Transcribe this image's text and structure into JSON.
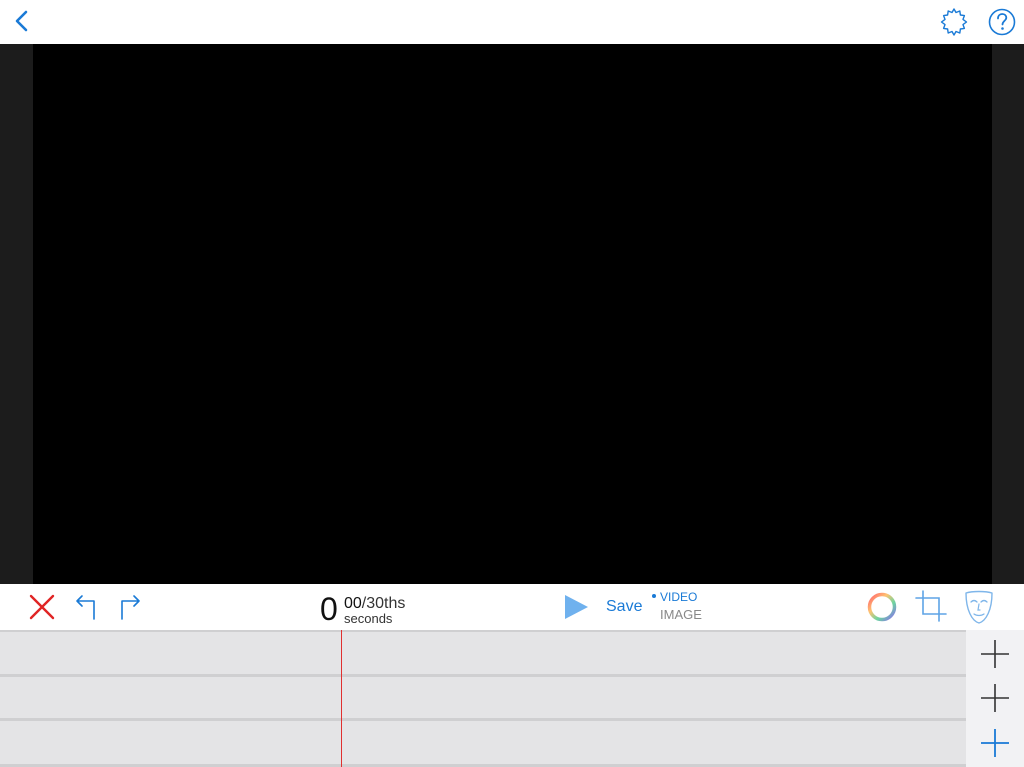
{
  "nav": {
    "back_icon": "chevron-left-icon",
    "settings_icon": "gear-icon",
    "help_icon": "question-mark-icon"
  },
  "toolbar": {
    "cancel_icon": "close-icon",
    "undo_icon": "undo-arrow-icon",
    "redo_icon": "redo-arrow-icon",
    "time": {
      "seconds": "0",
      "frames": "00",
      "frames_denominator": "/30ths",
      "unit": "seconds"
    },
    "play_icon": "play-icon",
    "save_label": "Save",
    "mode": {
      "video_label": "VIDEO",
      "image_label": "IMAGE",
      "selected": "VIDEO"
    },
    "color_icon": "color-wheel-icon",
    "crop_icon": "crop-icon",
    "mask_icon": "mask-icon"
  },
  "timeline": {
    "add_track_icons": [
      "plus-icon",
      "plus-icon",
      "plus-icon"
    ]
  },
  "colors": {
    "accent": "#1a7ad6",
    "cancel": "#e02424",
    "playhead": "#e03030",
    "canvas": "#000000"
  }
}
